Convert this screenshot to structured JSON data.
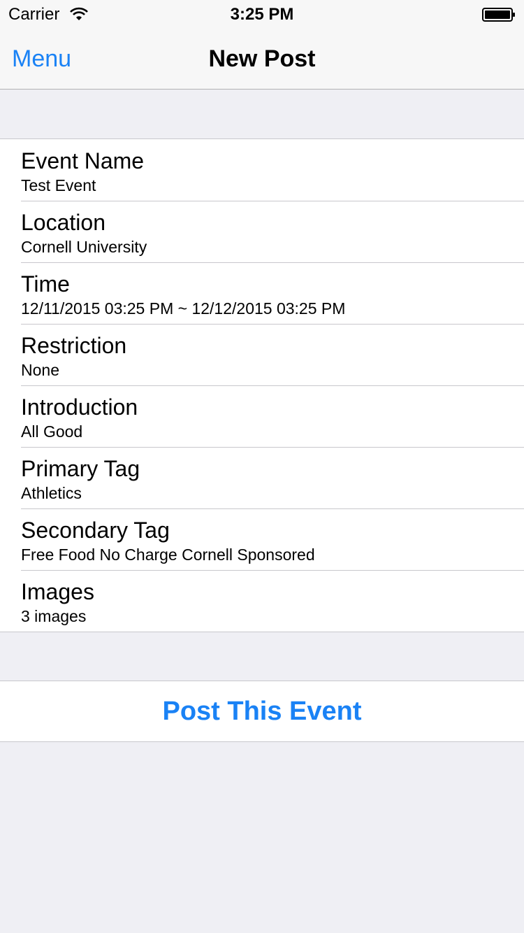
{
  "status_bar": {
    "carrier": "Carrier",
    "time": "3:25 PM",
    "wifi_icon": "wifi-icon",
    "battery_icon": "battery-icon"
  },
  "nav": {
    "left_button": "Menu",
    "title": "New Post"
  },
  "fields": [
    {
      "label": "Event Name",
      "value": "Test Event"
    },
    {
      "label": "Location",
      "value": "Cornell University"
    },
    {
      "label": "Time",
      "value": "12/11/2015 03:25 PM ~ 12/12/2015 03:25 PM"
    },
    {
      "label": "Restriction",
      "value": "None"
    },
    {
      "label": "Introduction",
      "value": "All Good"
    },
    {
      "label": "Primary Tag",
      "value": "Athletics"
    },
    {
      "label": "Secondary Tag",
      "value": "Free Food No Charge Cornell Sponsored"
    },
    {
      "label": "Images",
      "value": "3 images"
    }
  ],
  "action": {
    "label": "Post This Event"
  },
  "colors": {
    "accent": "#1a82f5",
    "background": "#efeff4",
    "cell": "#ffffff",
    "separator": "#c8c7cc"
  }
}
